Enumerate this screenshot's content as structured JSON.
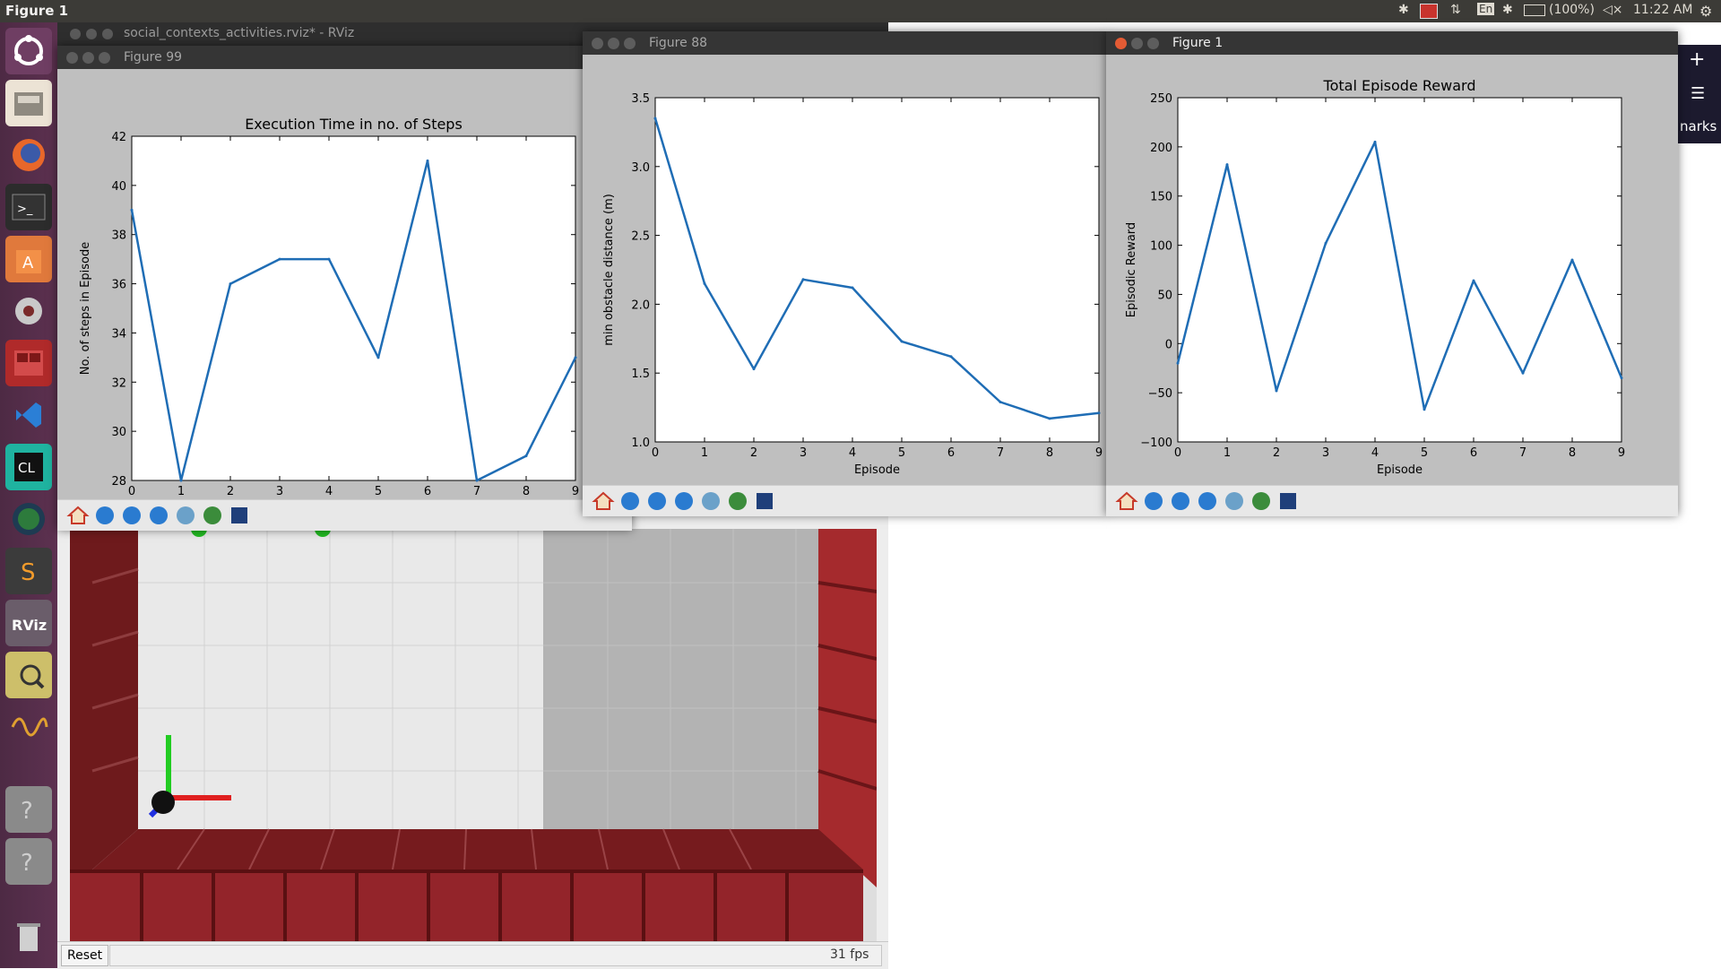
{
  "top_panel": {
    "title": "Figure 1",
    "input_language": "En",
    "battery": "(100%)",
    "clock": "11:22 AM"
  },
  "launcher": {
    "icons": [
      "ubuntu-dash-icon",
      "files-icon",
      "firefox-icon",
      "terminal-icon",
      "software-center-icon",
      "system-settings-icon",
      "workspace-switcher-icon",
      "vscode-icon",
      "clion-icon",
      "globe-icon",
      "sublime-text-icon",
      "rviz-icon",
      "image-viewer-icon",
      "oscilloscope-icon",
      "unknown-app-icon",
      "unknown-app-icon",
      "trash-icon"
    ]
  },
  "rviz": {
    "title": "social_contexts_activities.rviz* - RViz",
    "reset_label": "Reset",
    "fps": "31 fps",
    "right_panel_text": "narks"
  },
  "colors": {
    "line": "#1f6db5",
    "wall": "#8b1f22",
    "wall_dark": "#6a1518"
  },
  "figures": [
    {
      "window_title": "Figure 99",
      "active": false,
      "chart_data": {
        "type": "line",
        "title": "Execution Time in no. of Steps",
        "xlabel": "Episode",
        "ylabel": "No. of steps in Episode",
        "x": [
          0,
          1,
          2,
          3,
          4,
          5,
          6,
          7,
          8,
          9
        ],
        "y": [
          39,
          28,
          36,
          37,
          37,
          33,
          41,
          28,
          29,
          33
        ],
        "xlim": [
          0,
          9
        ],
        "ylim": [
          28,
          42
        ],
        "xticks": [
          0,
          1,
          2,
          3,
          4,
          5,
          6,
          7,
          8,
          9
        ],
        "yticks": [
          28,
          30,
          32,
          34,
          36,
          38,
          40,
          42
        ],
        "grid": false
      }
    },
    {
      "window_title": "Figure 88",
      "active": false,
      "chart_data": {
        "type": "line",
        "title": "",
        "xlabel": "Episode",
        "ylabel": "min obstacle distance (m)",
        "x": [
          0,
          1,
          2,
          3,
          4,
          5,
          6,
          7,
          8,
          9
        ],
        "y": [
          3.35,
          2.15,
          1.53,
          2.18,
          2.12,
          1.73,
          1.62,
          1.29,
          1.17,
          1.21
        ],
        "xlim": [
          0,
          9
        ],
        "ylim": [
          1.0,
          3.5
        ],
        "xticks": [
          0,
          1,
          2,
          3,
          4,
          5,
          6,
          7,
          8,
          9
        ],
        "yticks": [
          "1.0",
          "1.5",
          "2.0",
          "2.5",
          "3.0",
          "3.5"
        ],
        "grid": false
      }
    },
    {
      "window_title": "Figure 1",
      "active": true,
      "chart_data": {
        "type": "line",
        "title": "Total Episode Reward",
        "xlabel": "Episode",
        "ylabel": "Episodic Reward",
        "x": [
          0,
          1,
          2,
          3,
          4,
          5,
          6,
          7,
          8,
          9
        ],
        "y": [
          -20,
          182,
          -48,
          102,
          205,
          -67,
          64,
          -30,
          85,
          -35
        ],
        "xlim": [
          0,
          9
        ],
        "ylim": [
          -100,
          250
        ],
        "xticks": [
          0,
          1,
          2,
          3,
          4,
          5,
          6,
          7,
          8,
          9
        ],
        "yticks": [
          "−100",
          "−50",
          "0",
          "50",
          "100",
          "150",
          "200",
          "250"
        ],
        "grid": false
      }
    }
  ]
}
